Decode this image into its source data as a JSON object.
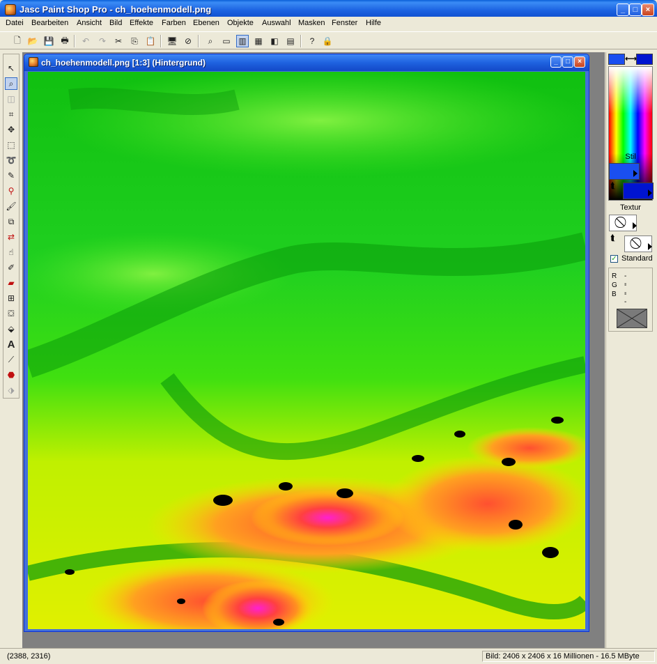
{
  "app": {
    "title": "Jasc Paint Shop Pro - ch_hoehenmodell.png",
    "controls": [
      "_",
      "□",
      "×"
    ]
  },
  "menu": [
    "Datei",
    "Bearbeiten",
    "Ansicht",
    "Bild",
    "Effekte",
    "Farben",
    "Ebenen",
    "Objekte",
    "Auswahl",
    "Masken",
    "Fenster",
    "Hilfe"
  ],
  "toolbar": {
    "icons": [
      "new-file-icon",
      "open-folder-icon",
      "save-icon",
      "print-icon",
      "undo-icon",
      "redo-icon",
      "cut-icon",
      "copy-icon",
      "paste-icon",
      "browse-icon",
      "no-icon",
      "zoom-icon",
      "overview-icon",
      "histogram-icon",
      "layers-icon",
      "color-palette-icon",
      "window-icon",
      "help-icon",
      "lock-icon"
    ]
  },
  "document": {
    "title": "ch_hoehenmodell.png [1:3] (Hintergrund)",
    "controls": [
      "_",
      "□",
      "×"
    ]
  },
  "palette": {
    "stil_label": "Stil",
    "textur_label": "Textur",
    "standard_label": "Standard",
    "standard_checked": "✓",
    "r_label": "R",
    "r_value": "--",
    "g_label": "G",
    "g_value": "--",
    "b_label": "B",
    "b_value": "--",
    "foreground_color": "#1a4ff0",
    "background_color": "#0014d0"
  },
  "status": {
    "coords": "(2388, 2316)",
    "info": "Bild:  2406 x 2406 x 16 Millionen - 16.5 MByte"
  }
}
